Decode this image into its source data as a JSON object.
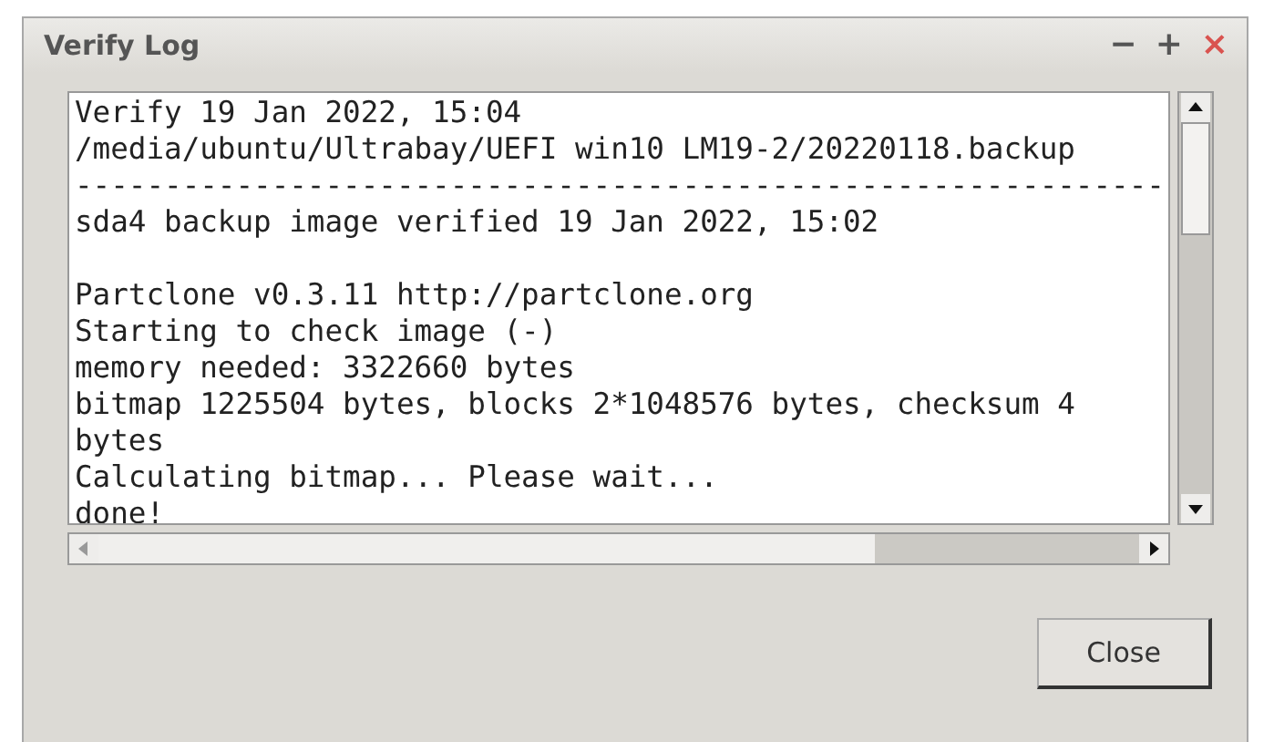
{
  "window": {
    "title": "Verify Log",
    "controls": [
      "−",
      "+",
      "×"
    ]
  },
  "log": {
    "paragraphs": [
      [
        "Verify 19 Jan 2022, 15:04",
        "/media/ubuntu/Ultrabay/UEFI win10 LM19-2/20220118.backup",
        "-------------------------------------------------------------",
        "sda4 backup image verified 19 Jan 2022, 15:02"
      ],
      [
        "Partclone v0.3.11 http://partclone.org",
        "Starting to check image (-)",
        "memory needed: 3322660 bytes",
        "bitmap 1225504 bytes, blocks 2*1048576 bytes, checksum 4",
        "bytes",
        "Calculating bitmap... Please wait...",
        "done!"
      ]
    ]
  },
  "buttons": [
    "Close"
  ]
}
